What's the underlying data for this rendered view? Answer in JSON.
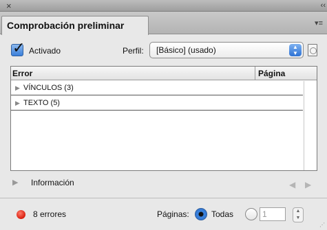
{
  "window": {
    "close_glyph": "×",
    "collapse_glyph": "‹‹"
  },
  "panel": {
    "tab_title": "Comprobación preliminar",
    "menu_glyph": "▾≡"
  },
  "controls": {
    "enabled_label": "Activado",
    "enabled_checked": true,
    "profile_label": "Perfil:",
    "profile_value": "[Básico] (usado)"
  },
  "table": {
    "columns": [
      "Error",
      "Página"
    ],
    "rows": [
      {
        "label": "VÍNCULOS (3)"
      },
      {
        "label": "TEXTO (5)"
      }
    ]
  },
  "info": {
    "label": "Información"
  },
  "status": {
    "color": "#d81f0f",
    "text": "8 errores",
    "pages_label": "Páginas:",
    "all_label": "Todas",
    "range_value": "1",
    "selected_option": "Todas"
  },
  "colors": {
    "accent": "#3a7fda",
    "error": "#d81f0f"
  }
}
